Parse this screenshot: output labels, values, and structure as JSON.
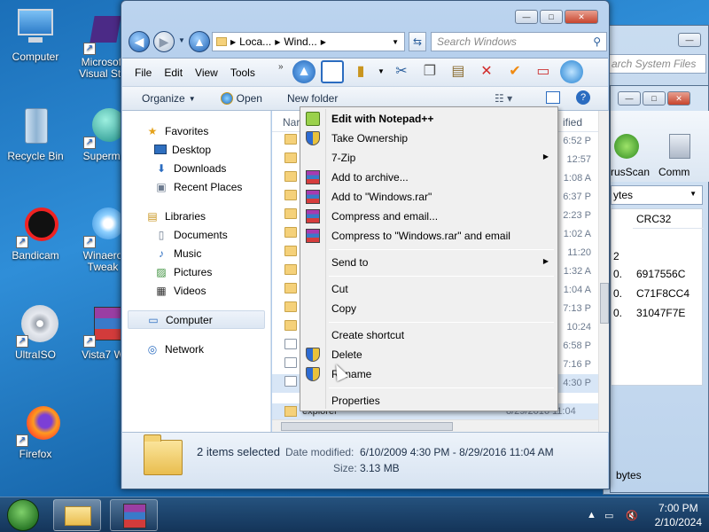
{
  "desktop": {
    "icons": [
      {
        "label": "Computer"
      },
      {
        "label": "Microsoft Visual Stu"
      },
      {
        "label": "Recycle Bin"
      },
      {
        "label": "Supermi"
      },
      {
        "label": "Bandicam"
      },
      {
        "label": "Winaero Tweak"
      },
      {
        "label": "UltraISO"
      },
      {
        "label": "Vista7 W"
      },
      {
        "label": "Firefox"
      }
    ]
  },
  "background_window": {
    "search_placeholder": "arch System Files",
    "virusscan_label": "rusScan",
    "comm_label": "Comm",
    "bytes_label": "ytes",
    "crc_header": "CRC32",
    "crc_values": [
      "6917556C",
      "C71F8CC4",
      "31047F7E"
    ],
    "row_prefixes": [
      "2",
      "0.",
      "0.",
      "0."
    ],
    "footer_bytes": "bytes"
  },
  "explorer": {
    "breadcrumb": [
      "Loca...",
      "Wind..."
    ],
    "search_placeholder": "Search Windows",
    "menu": [
      "File",
      "Edit",
      "View",
      "Tools"
    ],
    "commands": {
      "organize": "Organize",
      "open": "Open",
      "new_folder": "New folder"
    },
    "columns": {
      "name": "Nar",
      "modified": "ified"
    },
    "nav": {
      "favorites": "Favorites",
      "favorites_items": [
        "Desktop",
        "Downloads",
        "Recent Places"
      ],
      "libraries": "Libraries",
      "libraries_items": [
        "Documents",
        "Music",
        "Pictures",
        "Videos"
      ],
      "computer": "Computer",
      "network": "Network"
    },
    "file_times": [
      "6:52 P",
      "12:57",
      "1:08 A",
      "6:37 P",
      "2:23 P",
      "1:02 A",
      "11:20",
      "1:32 A",
      "1:04 A",
      "7:13 P",
      "10:24",
      "6:58 P",
      "7:16 P",
      "4:30 P",
      "11:04"
    ],
    "last_row_name": "explorer",
    "last_row_date": "8/29/2016 11:04",
    "details": {
      "selected": "2 items selected",
      "date_label": "Date modified:",
      "date_value": "6/10/2009 4:30 PM - 8/29/2016 11:04 AM",
      "size_label": "Size:",
      "size_value": "3.13 MB"
    }
  },
  "context_menu": {
    "items": [
      {
        "label": "Edit with Notepad++",
        "bold": true,
        "icon": "notepadpp-icon"
      },
      {
        "label": "Take Ownership",
        "icon": "shield-icon"
      },
      {
        "label": "7-Zip",
        "submenu": true
      },
      {
        "label": "Add to archive...",
        "icon": "winrar-icon"
      },
      {
        "label": "Add to \"Windows.rar\"",
        "icon": "winrar-icon"
      },
      {
        "label": "Compress and email...",
        "icon": "winrar-icon"
      },
      {
        "label": "Compress to \"Windows.rar\" and email",
        "icon": "winrar-icon"
      },
      {
        "label": "Send to",
        "submenu": true
      },
      {
        "label": "Cut"
      },
      {
        "label": "Copy"
      },
      {
        "label": "Create shortcut"
      },
      {
        "label": "Delete",
        "icon": "shield-icon"
      },
      {
        "label": "Rename",
        "icon": "shield-icon"
      },
      {
        "label": "Properties"
      }
    ]
  },
  "taskbar": {
    "time": "7:00 PM",
    "date": "2/10/2024"
  }
}
